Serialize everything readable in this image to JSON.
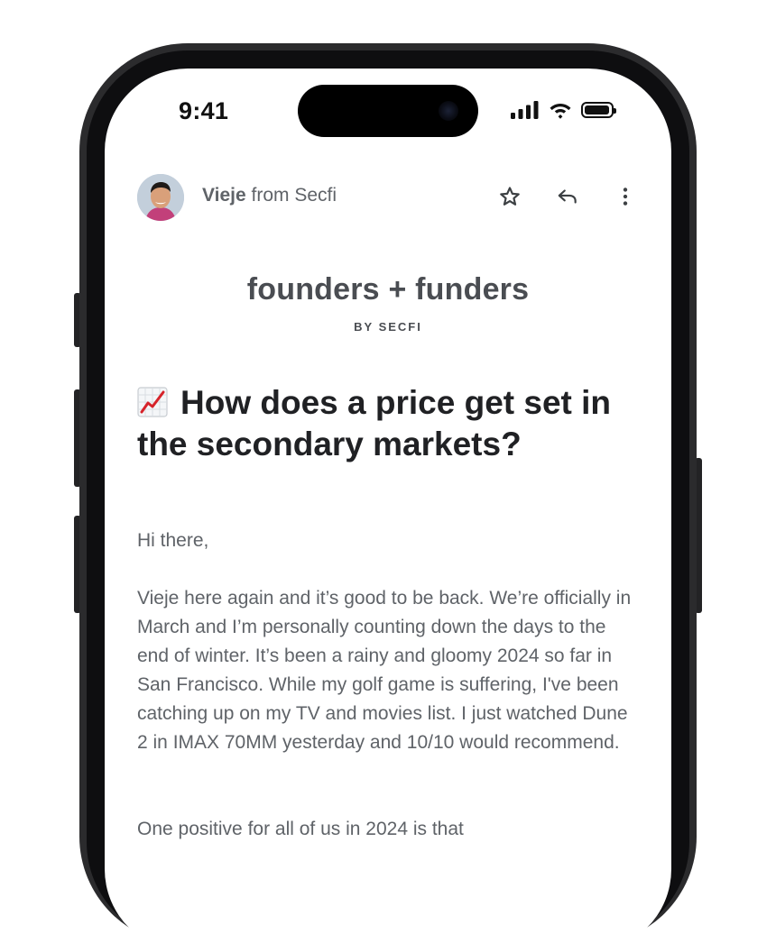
{
  "status_bar": {
    "time": "9:41"
  },
  "email": {
    "sender_name": "Vieje",
    "sender_suffix": " from Secfi",
    "actions": [
      "star-icon",
      "reply-icon",
      "more-vert-icon"
    ]
  },
  "newsletter": {
    "title": "founders + funders",
    "subtitle": "BY SECFI",
    "headline": "How does a price get set in the secondary markets?",
    "greeting": "Hi there,",
    "paragraph1": "Vieje here again and it’s good to be back. We’re officially in March and I’m personally counting down the days to the end of winter. It’s been a rainy and gloomy 2024 so far in San Francisco. While my golf game is suffering, I've been catching up on my TV and movies list. I just watched Dune 2 in IMAX 70MM yesterday and 10/10 would recommend.",
    "paragraph2": "One positive for all of us in 2024 is that"
  }
}
